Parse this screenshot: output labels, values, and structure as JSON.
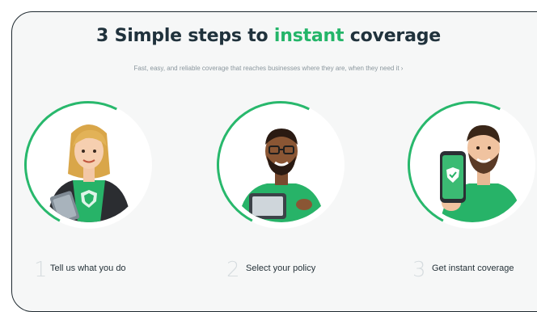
{
  "header": {
    "title_part1": "3 Simple steps to ",
    "title_accent": "instant",
    "title_part2": " coverage",
    "subtitle": "Fast, easy, and reliable coverage that reaches businesses where they are, when they need it ›"
  },
  "colors": {
    "accent": "#24b569",
    "title": "#20323c",
    "number": "#d6dcdf"
  },
  "steps": [
    {
      "number": "1",
      "label": "Tell us what you do",
      "icon": "woman-with-tablet-illustration"
    },
    {
      "number": "2",
      "label": "Select your policy",
      "icon": "man-with-tablet-illustration"
    },
    {
      "number": "3",
      "label": "Get instant coverage",
      "icon": "man-with-phone-shield-illustration"
    }
  ]
}
